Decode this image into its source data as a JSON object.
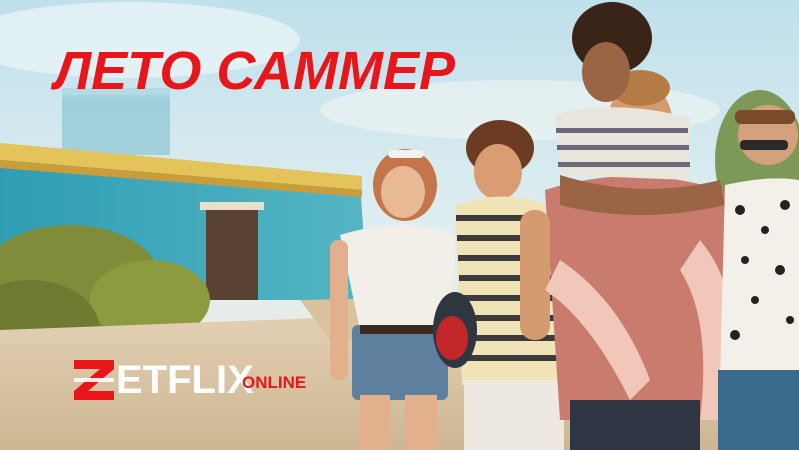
{
  "poster": {
    "title": "ЛЕТО САММЕР",
    "title_color": "#e8161b"
  },
  "logo": {
    "mark_letter": "Z",
    "word": "ETFLIX",
    "suffix": "ONLINE",
    "accent_color": "#e8161b"
  }
}
